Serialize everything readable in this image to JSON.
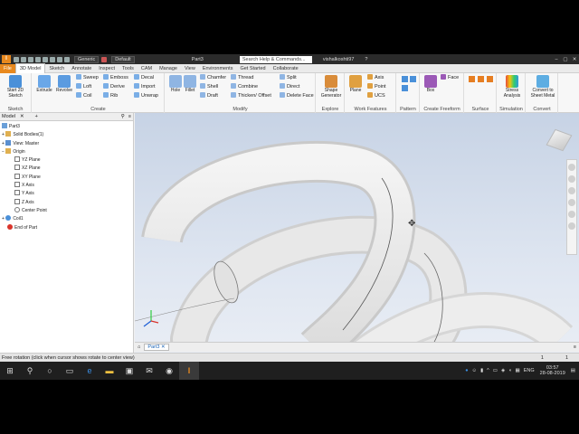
{
  "titlebar": {
    "logo": "I",
    "app_menu_label": "Generic",
    "appearance_label": "Default",
    "doc_title": "Part3",
    "search_placeholder": "Search Help & Commands...",
    "user": "vishalkoshti97",
    "help": "?",
    "minimize": "–",
    "maximize": "▢",
    "close": "✕"
  },
  "menu_tabs": [
    "File",
    "3D Model",
    "Sketch",
    "Annotate",
    "Inspect",
    "Tools",
    "CAM",
    "Manage",
    "View",
    "Environments",
    "Get Started",
    "Collaborate"
  ],
  "ribbon": {
    "sketch": {
      "start_sketch": "Start 2D Sketch",
      "label": "Sketch"
    },
    "create": {
      "extrude": "Extrude",
      "revolve": "Revolve",
      "sweep": "Sweep",
      "loft": "Loft",
      "coil": "Coil",
      "emboss": "Emboss",
      "derive": "Derive",
      "rib": "Rib",
      "decal": "Decal",
      "import": "Import",
      "unwrap": "Unwrap",
      "label": "Create"
    },
    "modify": {
      "hole": "Hole",
      "fillet": "Fillet",
      "chamfer": "Chamfer",
      "shell": "Shell",
      "draft": "Draft",
      "thread": "Thread",
      "combine": "Combine",
      "thicken": "Thicken/ Offset",
      "split": "Split",
      "direct": "Direct",
      "delete_face": "Delete Face",
      "label": "Modify"
    },
    "explore": {
      "shape_generator": "Shape Generator",
      "label": "Explore"
    },
    "work_features": {
      "plane": "Plane",
      "axis": "Axis",
      "point": "Point",
      "ucs": "UCS",
      "label": "Work Features"
    },
    "pattern": {
      "label": "Pattern"
    },
    "freeform": {
      "box": "Box",
      "face": "Face",
      "label": "Create Freeform"
    },
    "surface": {
      "label": "Surface"
    },
    "simulation": {
      "stress": "Stress Analysis",
      "label": "Simulation"
    },
    "convert": {
      "sheet_metal": "Convert to Sheet Metal",
      "label": "Convert"
    }
  },
  "browser": {
    "title": "Model",
    "close": "✕",
    "add": "+",
    "items": [
      "Part3",
      "Solid Bodies(1)",
      "View: Master",
      "Origin",
      "YZ Plane",
      "XZ Plane",
      "XY Plane",
      "X Axis",
      "Y Axis",
      "Z Axis",
      "Center Point",
      "Coil1",
      "End of Part"
    ]
  },
  "doc_tab": "Part3",
  "status": {
    "message": "Free rotation (click when cursor shows rotate to center view)",
    "page_a": "1",
    "page_b": "1"
  },
  "taskbar": {
    "lang": "ENG",
    "time": "03:57",
    "date": "28-08-2019"
  },
  "colors": {
    "accent": "#e8891f",
    "viewport_top": "#c7d3e5",
    "viewport_bottom": "#eef1f6"
  }
}
